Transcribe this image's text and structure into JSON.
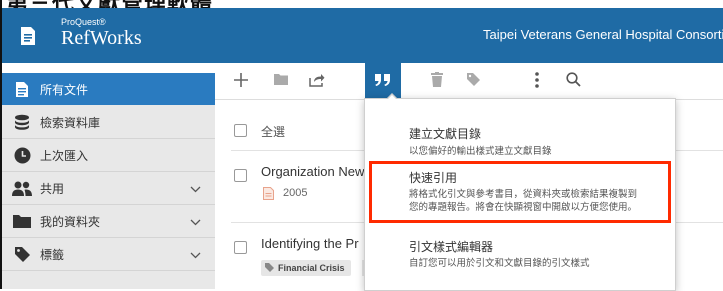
{
  "top_strip": {
    "text": "第三代文獻管理軟體"
  },
  "header": {
    "brand_small": "ProQuest®",
    "brand_big": "RefWorks",
    "organization": "Taipei Veterans General Hospital Consortiun"
  },
  "sidebar": {
    "items": [
      {
        "label": "所有文件",
        "icon": "document-icon",
        "active": true
      },
      {
        "label": "檢索資料庫",
        "icon": "database-icon"
      },
      {
        "label": "上次匯入",
        "icon": "clock-icon"
      },
      {
        "label": "共用",
        "icon": "people-icon",
        "expandable": true
      },
      {
        "label": "我的資料夾",
        "icon": "folder-icon",
        "expandable": true
      },
      {
        "label": "標籤",
        "icon": "tag-icon",
        "expandable": true
      }
    ]
  },
  "toolbar": {
    "buttons": [
      {
        "icon": "plus-icon"
      },
      {
        "icon": "folder-icon"
      },
      {
        "icon": "share-icon"
      },
      {
        "icon": "quote-icon",
        "active": true
      },
      {
        "icon": "trash-icon"
      },
      {
        "icon": "tag-icon"
      },
      {
        "icon": "more-vertical-icon"
      },
      {
        "icon": "search-icon"
      }
    ]
  },
  "list": {
    "select_all": "全選",
    "rows": [
      {
        "title": "Organization New",
        "year": "2005"
      },
      {
        "title": "Identifying the Pr",
        "tag": "Financial Crisis"
      }
    ]
  },
  "citation_menu": {
    "items": [
      {
        "title": "建立文獻目錄",
        "desc": [
          "以您偏好的輸出樣式建立文獻目錄"
        ]
      },
      {
        "title": "快速引用",
        "desc": [
          "將格式化引文與參考書目，從資料夾或檢索結果複製到",
          "您的專題報告。將會在快顯視窗中開啟以方便您使用。"
        ],
        "highlighted": true
      },
      {
        "title": "引文樣式編輯器",
        "desc": [
          "自訂您可以用於引文和文獻目錄的引文樣式"
        ]
      }
    ]
  },
  "colors": {
    "header": "#1f6ba5",
    "active": "#2a7bc0",
    "highlight": "#ff2a00"
  }
}
